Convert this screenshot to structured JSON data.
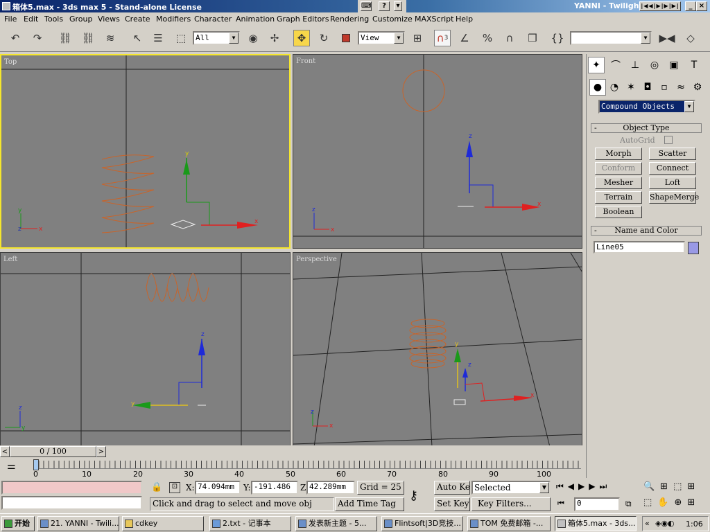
{
  "window": {
    "title": "箱体5.max - 3ds max 5 - Stand-alone License",
    "right_title": "YANNI - Twilight"
  },
  "menu": [
    "File",
    "Edit",
    "Tools",
    "Group",
    "Views",
    "Create",
    "Modifiers",
    "Character",
    "Animation",
    "Graph Editors",
    "Rendering",
    "Customize",
    "MAXScript",
    "Help"
  ],
  "toolbar": {
    "selection_filter": "All",
    "ref_coord": "View",
    "named_sel": "",
    "snap_label": "3",
    "percent_label": "%"
  },
  "viewports": {
    "top": "Top",
    "front": "Front",
    "left": "Left",
    "perspective": "Perspective"
  },
  "axes": {
    "x": "x",
    "y": "y",
    "z": "z"
  },
  "command_panel": {
    "category": "Compound Objects",
    "object_type_title": "Object Type",
    "autogrid": "AutoGrid",
    "buttons": [
      "Morph",
      "Scatter",
      "Conform",
      "Connect",
      "Mesher",
      "Loft",
      "Terrain",
      "ShapeMerge",
      "Boolean"
    ],
    "name_color_title": "Name and Color",
    "object_name": "Line05",
    "object_color": "#9999e5"
  },
  "time": {
    "slider": "0 / 100",
    "ticks": [
      "0",
      "10",
      "20",
      "30",
      "40",
      "50",
      "60",
      "70",
      "80",
      "90",
      "100"
    ]
  },
  "status": {
    "x_label": "X:",
    "x": "74.094mm",
    "y_label": "Y:",
    "y": "-191.486",
    "z_label": "Z:",
    "z": "42.289mm",
    "grid": "Grid = 25",
    "prompt": "Click and drag to select and move obj",
    "add_time_tag": "Add Time Tag",
    "auto_key": "Auto Key",
    "set_key": "Set Key",
    "key_mode": "Selected",
    "key_filters": "Key Filters...",
    "frame": "0"
  },
  "taskbar": {
    "start": "开始",
    "tasks": [
      "21. YANNI - Twili...",
      "cdkey",
      "2.txt - 记事本",
      "发表新主题 - 5...",
      "Flintsoft|3D竞技...",
      "TOM 免费邮箱 -...",
      "箱体5.max - 3ds..."
    ],
    "clock": "1:06"
  }
}
